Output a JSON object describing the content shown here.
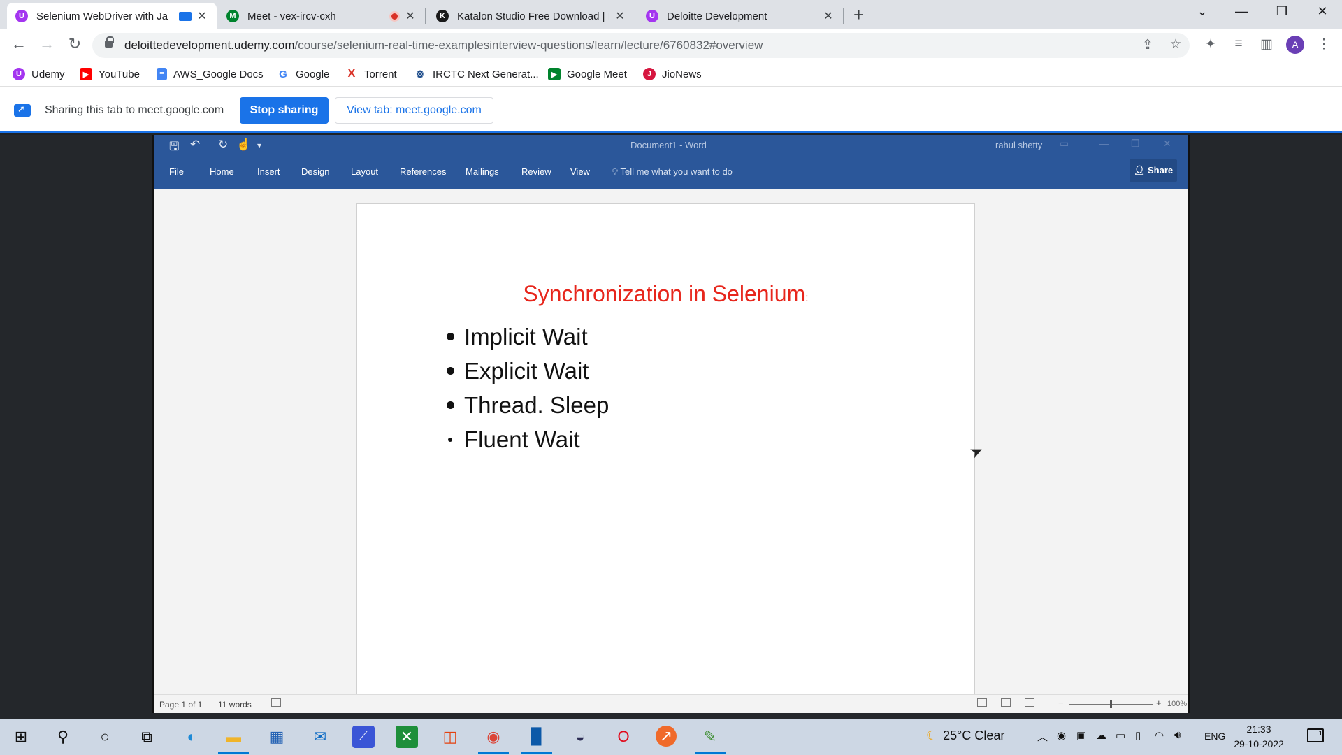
{
  "browser": {
    "tabs": [
      {
        "title": "Selenium WebDriver with Ja",
        "active": true,
        "favicon_color": "#a435f0"
      },
      {
        "title": "Meet - vex-ircv-cxh",
        "active": false,
        "favicon_color": "#00832d"
      },
      {
        "title": "Katalon Studio Free Download | K",
        "active": false,
        "favicon_color": "#1a1a1a"
      },
      {
        "title": "Deloitte Development",
        "active": false,
        "favicon_color": "#a435f0"
      }
    ],
    "url_host": "deloittedevelopment.udemy.com",
    "url_path": "/course/selenium-real-time-examplesinterview-questions/learn/lecture/6760832#overview",
    "profile_initial": "A",
    "bookmarks": [
      {
        "label": "Udemy",
        "icon": "udemy-icon",
        "color": "#a435f0"
      },
      {
        "label": "YouTube",
        "icon": "youtube-icon",
        "color": "#ff0000"
      },
      {
        "label": "AWS_Google Docs",
        "icon": "docs-icon",
        "color": "#4285f4"
      },
      {
        "label": "Google",
        "icon": "google-icon",
        "color": "#ea4335"
      },
      {
        "label": "Torrent",
        "icon": "torrent-icon",
        "color": "#d93025"
      },
      {
        "label": "IRCTC Next Generat...",
        "icon": "irctc-icon",
        "color": "#1f4e8c"
      },
      {
        "label": "Google Meet",
        "icon": "meet-icon",
        "color": "#00832d"
      },
      {
        "label": "JioNews",
        "icon": "jionews-icon",
        "color": "#d6163f"
      }
    ]
  },
  "sharebar": {
    "text": "Sharing this tab to meet.google.com",
    "stop_label": "Stop sharing",
    "view_label": "View tab: meet.google.com"
  },
  "word": {
    "window_title": "Document1 - Word",
    "user": "rahul shetty",
    "ribbon_tabs": [
      "File",
      "Home",
      "Insert",
      "Design",
      "Layout",
      "References",
      "Mailings",
      "Review",
      "View"
    ],
    "tell_me": "Tell me what you want to do",
    "share_label": "Share",
    "heading": "Synchronization in Selenium",
    "heading_suffix": ":",
    "bullets": [
      "Implicit Wait",
      "Explicit Wait",
      "Thread. Sleep",
      "Fluent Wait"
    ],
    "status_page": "Page 1 of 1",
    "status_words": "11 words",
    "zoom": "100%"
  },
  "taskbar": {
    "weather_temp": "25°C",
    "weather_desc": "Clear",
    "language": "ENG",
    "time": "21:33",
    "date": "29-10-2022",
    "notifications": "1"
  }
}
